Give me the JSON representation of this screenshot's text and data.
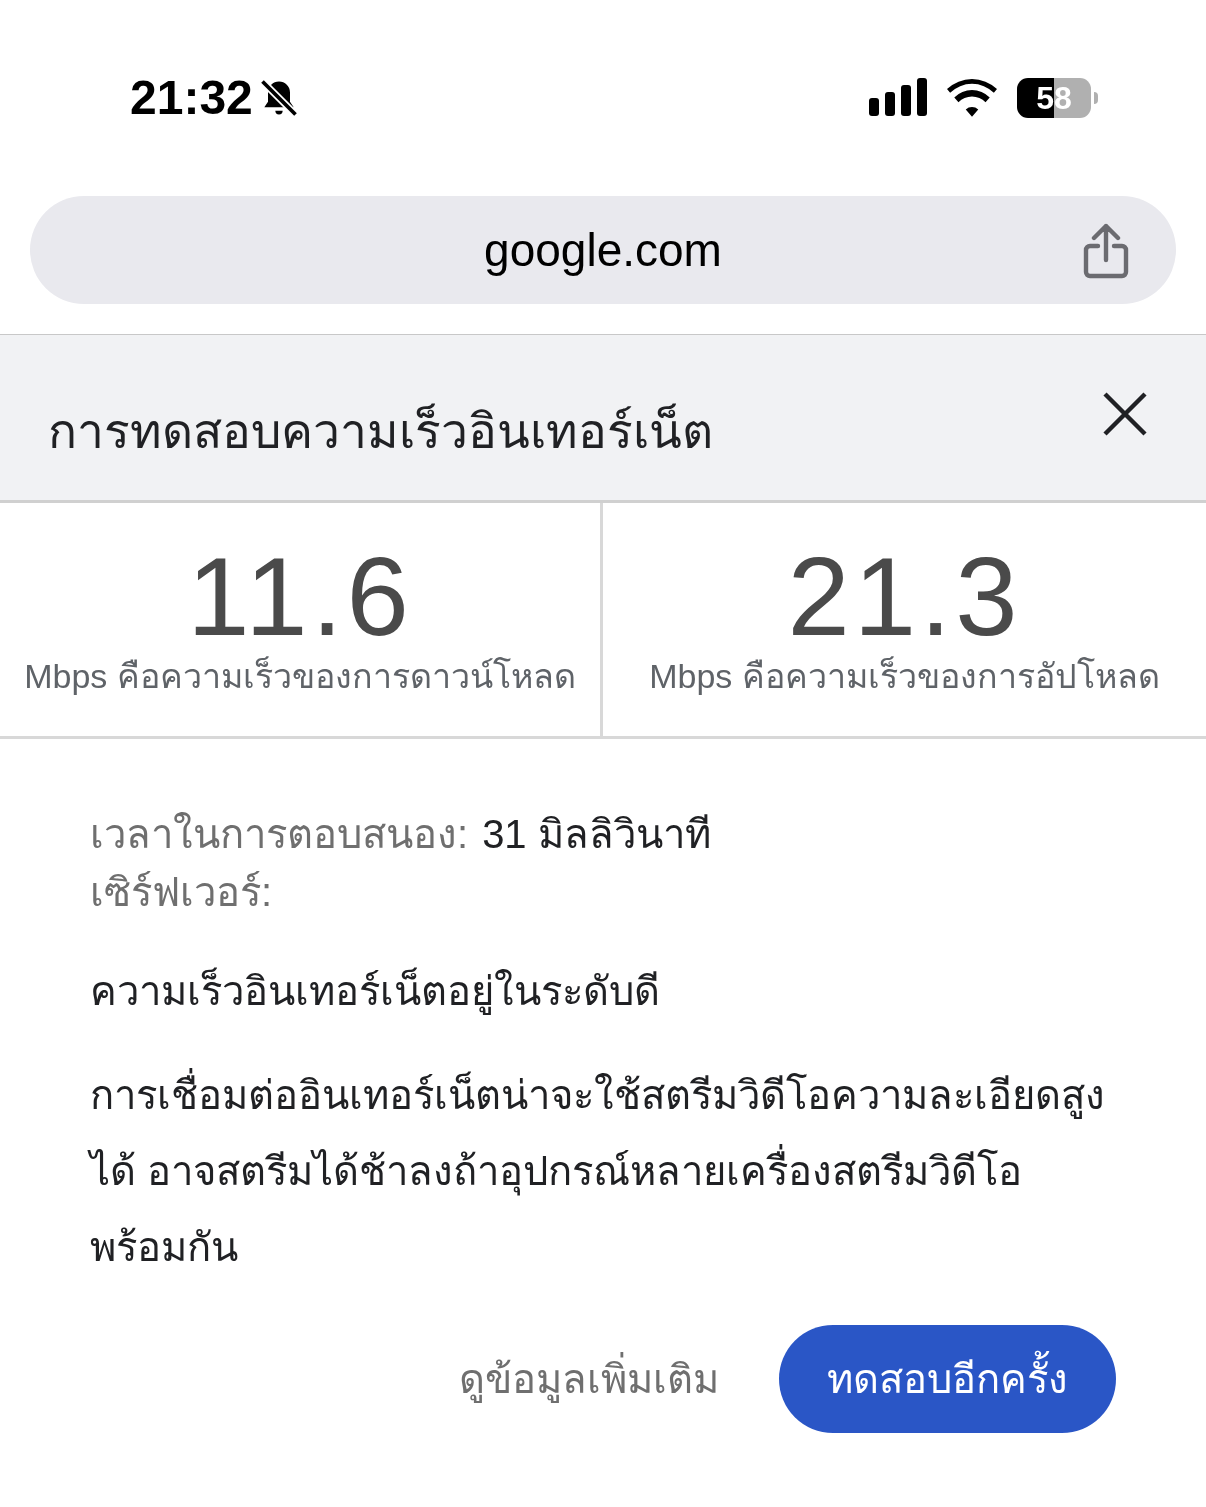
{
  "status_bar": {
    "time": "21:32",
    "battery": "58"
  },
  "address_bar": {
    "url": "google.com"
  },
  "card": {
    "title": "การทดสอบความเร็วอินเทอร์เน็ต",
    "results": [
      {
        "value": "11.6",
        "caption": "Mbps คือความเร็วของการดาวน์โหลด"
      },
      {
        "value": "21.3",
        "caption": "Mbps คือความเร็วของการอัปโหลด"
      }
    ],
    "details": [
      {
        "label": "เวลาในการตอบสนอง:",
        "value": "31 มิลลิวินาที"
      },
      {
        "label": "เซิร์ฟเวอร์:"
      }
    ],
    "verdict": "ความเร็วอินเทอร์เน็ตอยู่ในระดับดี",
    "description": "การเชื่อมต่ออินเทอร์เน็ตน่าจะใช้สตรีมวิดีโอความละเอียดสูงได้ อาจสตรีมได้ช้าลงถ้าอุปกรณ์หลายเครื่องสตรีมวิดีโอพร้อมกัน",
    "buttons": [
      {
        "label": "ดูข้อมูลเพิ่มเติม",
        "kind": "text"
      },
      {
        "label": "ทดสอบอีกครั้ง",
        "kind": "filled"
      }
    ]
  }
}
